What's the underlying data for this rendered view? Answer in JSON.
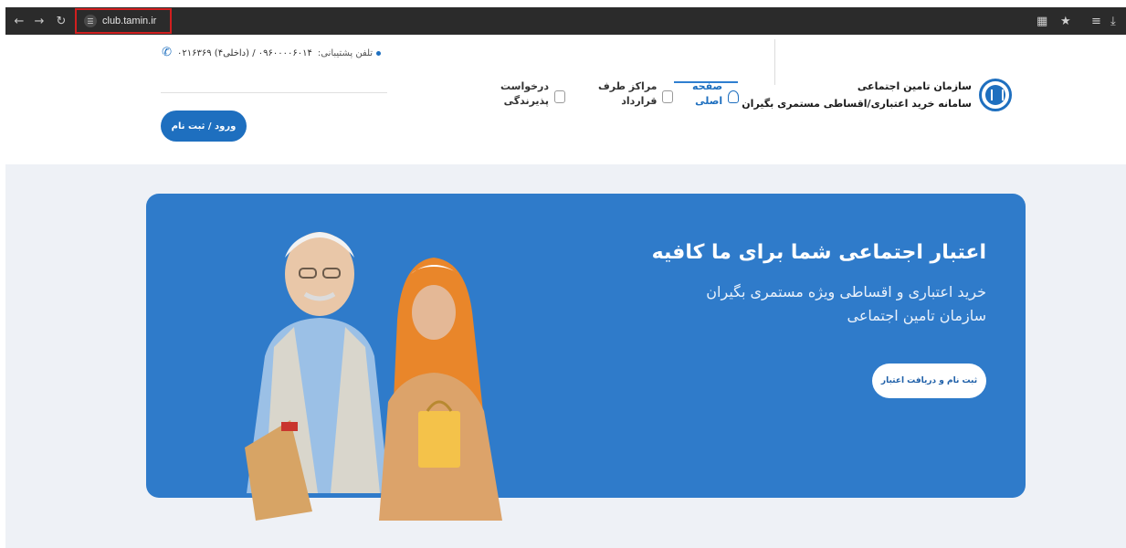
{
  "browser": {
    "url": "club.tamin.ir",
    "nav_icons": [
      "arrow-left-icon",
      "arrow-right-icon",
      "reload-icon"
    ],
    "toolbar_icons": [
      "translate-icon",
      "star-icon",
      "reading-list-icon",
      "download-icon"
    ]
  },
  "header": {
    "brand_title": "سازمان تامین اجتماعی",
    "brand_subtitle": "سامانه خرید اعتباری/اقساطی مستمری بگیران",
    "nav": [
      {
        "line1": "صفحه",
        "line2": "اصلی",
        "icon": "home-icon"
      },
      {
        "line1": "مراکز طرف",
        "line2": "قرارداد",
        "icon": "store-icon"
      },
      {
        "line1": "درخواست",
        "line2": "پذیرندگی",
        "icon": "document-icon"
      }
    ],
    "support_label": "تلفن پشتیبانی:",
    "support_number": "۰۹۶۰۰۰۰۶۰۱۴ / (داخلی۴) ۰۲۱۶۳۶۹",
    "login_label": "ورود / ثبت نام"
  },
  "hero": {
    "title": "اعتبار اجتماعی شما برای ما کافیه",
    "subtitle": "خرید اعتباری و اقساطی ویژه مستمری بگیران سازمان تامین اجتماعی",
    "cta_label": "ثبت نام و دریافت اعتبار"
  },
  "colors": {
    "primary": "#1e6fbf",
    "hero_bg": "#2f7bca",
    "page_bg": "#eef1f6",
    "url_highlight": "#d11f1f"
  }
}
